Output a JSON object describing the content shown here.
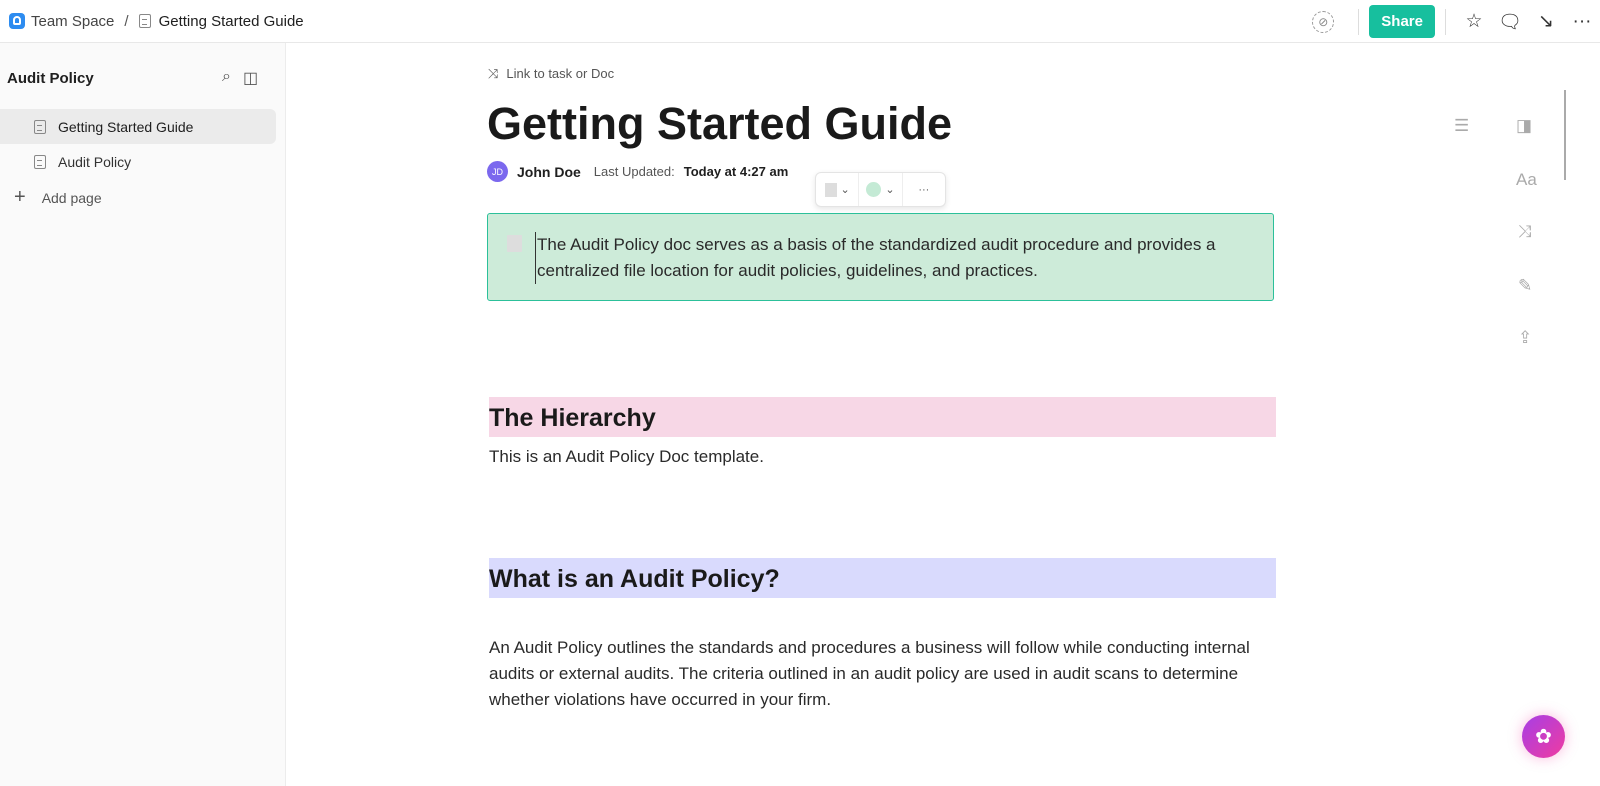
{
  "breadcrumb": {
    "space": "Team Space",
    "separator": "/",
    "doc": "Getting Started Guide"
  },
  "toolbar": {
    "share_label": "Share",
    "more": "···"
  },
  "sidebar": {
    "title": "Audit Policy",
    "items": [
      {
        "label": "Getting Started Guide",
        "active": true
      },
      {
        "label": "Audit Policy",
        "active": false
      }
    ],
    "add_page": "Add page"
  },
  "doc": {
    "link_label": "Link to task or Doc",
    "title": "Getting Started Guide",
    "author_initials": "JD",
    "author": "John Doe",
    "last_updated_label": "Last Updated:",
    "last_updated": "Today at 4:27 am",
    "callout": "The Audit Policy doc serves as a basis of the standardized audit procedure and provides a centralized file location for audit policies, guidelines, and practices.",
    "sections": [
      {
        "heading": "The Hierarchy",
        "body": "This is an Audit Policy Doc template."
      },
      {
        "heading": "What is an Audit Policy?",
        "body": "An Audit Policy outlines the standards and procedures a business will follow while conducting internal audits or external audits. The criteria outlined in an audit policy are used in audit scans to determine whether violations have occurred in your firm."
      }
    ],
    "format_more": "···",
    "rail_font": "Aa"
  },
  "colors": {
    "accent": "#17bf9e",
    "callout_bg": "#cdebd9",
    "h_pink": "#f7d7e6",
    "h_purple": "#d9dafd"
  }
}
